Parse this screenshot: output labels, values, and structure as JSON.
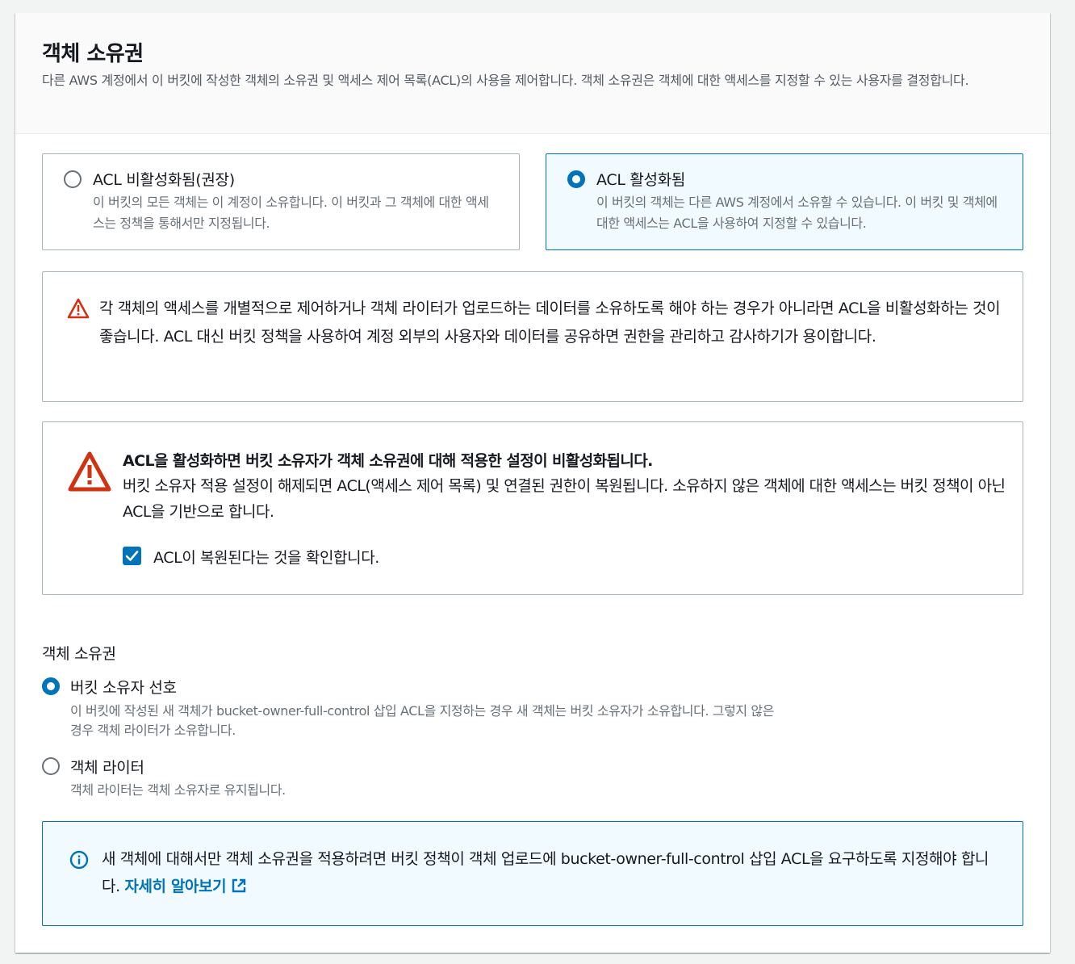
{
  "header": {
    "title": "객체 소유권",
    "description": "다른 AWS 계정에서 이 버킷에 작성한 객체의 소유권 및 액세스 제어 목록(ACL)의 사용을 제어합니다. 객체 소유권은 객체에 대한 액세스를 지정할 수 있는 사용자를 결정합니다."
  },
  "acl_tiles": [
    {
      "label": "ACL 비활성화됨(권장)",
      "description": "이 버킷의 모든 객체는 이 계정이 소유합니다. 이 버킷과 그 객체에 대한 액세스는 정책을 통해서만 지정됩니다.",
      "selected": false
    },
    {
      "label": "ACL 활성화됨",
      "description": "이 버킷의 객체는 다른 AWS 계정에서 소유할 수 있습니다. 이 버킷 및 객체에 대한 액세스는 ACL을 사용하여 지정할 수 있습니다.",
      "selected": true
    }
  ],
  "warning_recommend": {
    "icon": "warning-icon",
    "text": "각 객체의 액세스를 개별적으로 제어하거나 객체 라이터가 업로드하는 데이터를 소유하도록 해야 하는 경우가 아니라면 ACL을 비활성화하는 것이 좋습니다. ACL 대신 버킷 정책을 사용하여 계정 외부의 사용자와 데이터를 공유하면 권한을 관리하고 감사하기가 용이합니다."
  },
  "warning_restore": {
    "icon": "warning-icon",
    "heading": "ACL을 활성화하면 버킷 소유자가 객체 소유권에 대해 적용한 설정이 비활성화됩니다.",
    "body": "버킷 소유자 적용 설정이 해제되면 ACL(액세스 제어 목록) 및 연결된 권한이 복원됩니다. 소유하지 않은 객체에 대한 액세스는 버킷 정책이 아닌 ACL을 기반으로 합니다.",
    "checkbox_label": "ACL이 복원된다는 것을 확인합니다.",
    "checkbox_checked": true
  },
  "ownership": {
    "label": "객체 소유권",
    "options": [
      {
        "label": "버킷 소유자 선호",
        "description": "이 버킷에 작성된 새 객체가 bucket-owner-full-control 삽입 ACL을 지정하는 경우 새 객체는 버킷 소유자가 소유합니다. 그렇지 않은 경우 객체 라이터가 소유합니다.",
        "selected": true
      },
      {
        "label": "객체 라이터",
        "description": "객체 라이터는 객체 소유자로 유지됩니다.",
        "selected": false
      }
    ]
  },
  "info": {
    "icon": "info-icon",
    "text": "새 객체에 대해서만 객체 소유권을 적용하려면 버킷 정책이 객체 업로드에 bucket-owner-full-control 삽입 ACL을 요구하도록 지정해야 합니다.",
    "link_label": "자세히 알아보기",
    "link_icon": "external-link-icon"
  },
  "colors": {
    "accent": "#0073bb",
    "warning": "#d13212",
    "border": "#aab7b8",
    "selected_bg": "#f1faff"
  }
}
